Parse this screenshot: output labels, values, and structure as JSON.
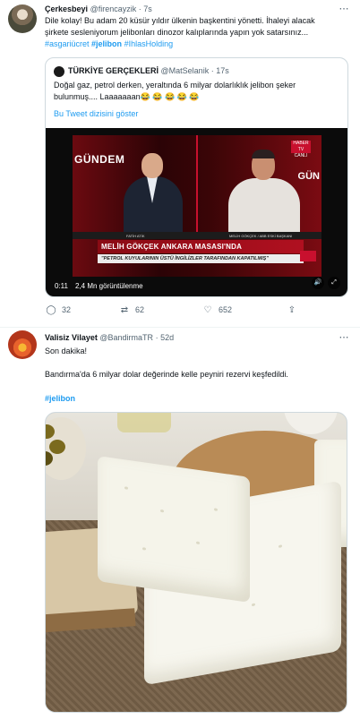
{
  "tweet1": {
    "name": "Çerkesbeyi",
    "handle": "@firencayzik",
    "dot": "·",
    "time": "7s",
    "text_line1": "Dile kolay! Bu adam 20 küsür yıldır ülkenin başkentini yönetti. İhaleyi alacak",
    "text_line2": "şirkete sesleniyorum jelibonları dinozor kalıplarında yapın yok satarsınız...",
    "hashtags": [
      "#asgariücret",
      "#jelibon",
      "#IhlasHolding"
    ],
    "quote": {
      "name": "TÜRKİYE GERÇEKLERİ",
      "handle": "@MatSelanik",
      "dot": "·",
      "time": "17s",
      "text_line1": "Doğal gaz, petrol derken, yeraltında 6 milyar dolarlıklık jelibon şeker",
      "text_line2": "bulunmuş.... Laaaaaaan😂 😂 😂 😂 😂",
      "thread_link": "Bu Tweet dizisini göster",
      "video": {
        "gundem_left": "GÜNDEM",
        "gundem_right": "GÜN",
        "live_label": "HABER TV CANLI",
        "name_left": "FATİH ATİK",
        "name_right": "MELİH GÖKÇEK / ABB ESKİ BAŞKANI",
        "lower_third": "MELİH GÖKÇEK ANKARA MASASI'NDA",
        "lower_sub": "\"PETROL KUYULARININ ÜSTÜ İNGİLİZLER TARAFINDAN KAPATILMIŞ\"",
        "duration": "0:11",
        "views": "2,4 Mn görüntülenme",
        "mute_icon": "speaker-icon",
        "fullscreen_icon": "expand-icon"
      }
    },
    "actions": {
      "reply_count": "32",
      "retweet_count": "62",
      "like_count": "652"
    },
    "more_icon": "⋯"
  },
  "tweet2": {
    "name": "Valisiz Vilayet",
    "handle": "@BandirmaTR",
    "dot": "·",
    "time": "52d",
    "line1": "Son dakika!",
    "line2": "Bandırma'da 6 milyar dolar değerinde kelle peyniri rezervi keşfedildi.",
    "hashtag": "#jelibon",
    "more_icon": "⋯"
  },
  "colors": {
    "accent": "#1d9bf0",
    "text": "#0f1419",
    "muted": "#536471",
    "border": "#cfd9de"
  }
}
